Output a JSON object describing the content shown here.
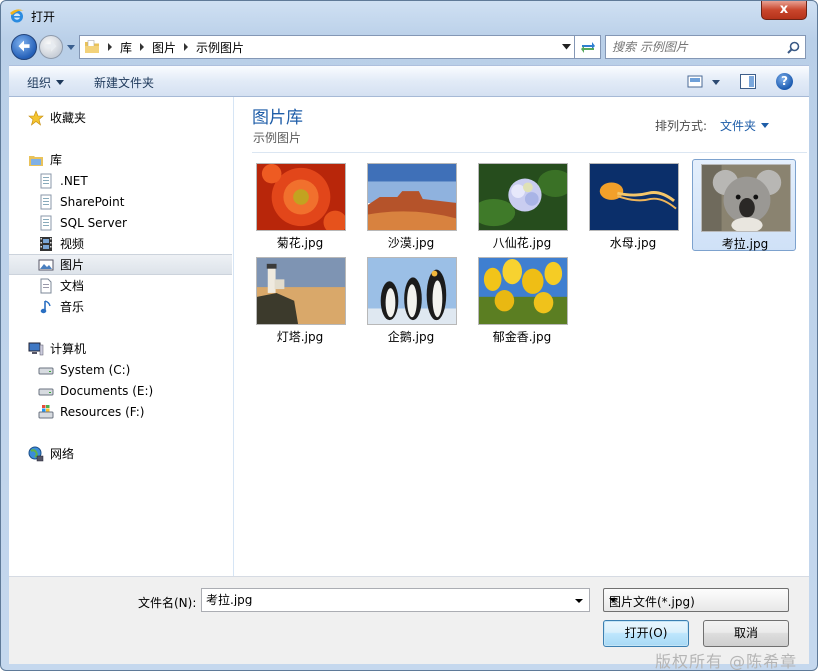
{
  "window": {
    "title": "打开",
    "close_glyph": "x"
  },
  "address": {
    "crumbs": [
      "库",
      "图片",
      "示例图片"
    ]
  },
  "search": {
    "placeholder": "搜索 示例图片"
  },
  "toolbar": {
    "organize": "组织",
    "new_folder": "新建文件夹",
    "help_glyph": "?"
  },
  "sidebar": {
    "favorites": "收藏夹",
    "libraries": "库",
    "library_items": [
      ".NET",
      "SharePoint",
      "SQL Server",
      "视频",
      "图片",
      "文档",
      "音乐"
    ],
    "computer": "计算机",
    "drives": [
      "System (C:)",
      "Documents (E:)",
      "Resources (F:)"
    ],
    "network": "网络",
    "selected": "图片"
  },
  "content": {
    "title": "图片库",
    "subtitle": "示例图片",
    "arrange_label": "排列方式:",
    "arrange_value": "文件夹",
    "files": [
      {
        "name": "菊花.jpg",
        "selected": false
      },
      {
        "name": "沙漠.jpg",
        "selected": false
      },
      {
        "name": "八仙花.jpg",
        "selected": false
      },
      {
        "name": "水母.jpg",
        "selected": false
      },
      {
        "name": "考拉.jpg",
        "selected": true
      },
      {
        "name": "灯塔.jpg",
        "selected": false
      },
      {
        "name": "企鹅.jpg",
        "selected": false
      },
      {
        "name": "郁金香.jpg",
        "selected": false
      }
    ]
  },
  "footer": {
    "filename_label": "文件名(N):",
    "filename_value": "考拉.jpg",
    "filetype_value": "图片文件(*.jpg)",
    "open_button": "打开(O)",
    "cancel_button": "取消",
    "watermark": "版权所有 @陈希章"
  },
  "colors": {
    "accent": "#1e5da8",
    "selection": "#cfe1f7",
    "close": "#c9462c"
  }
}
